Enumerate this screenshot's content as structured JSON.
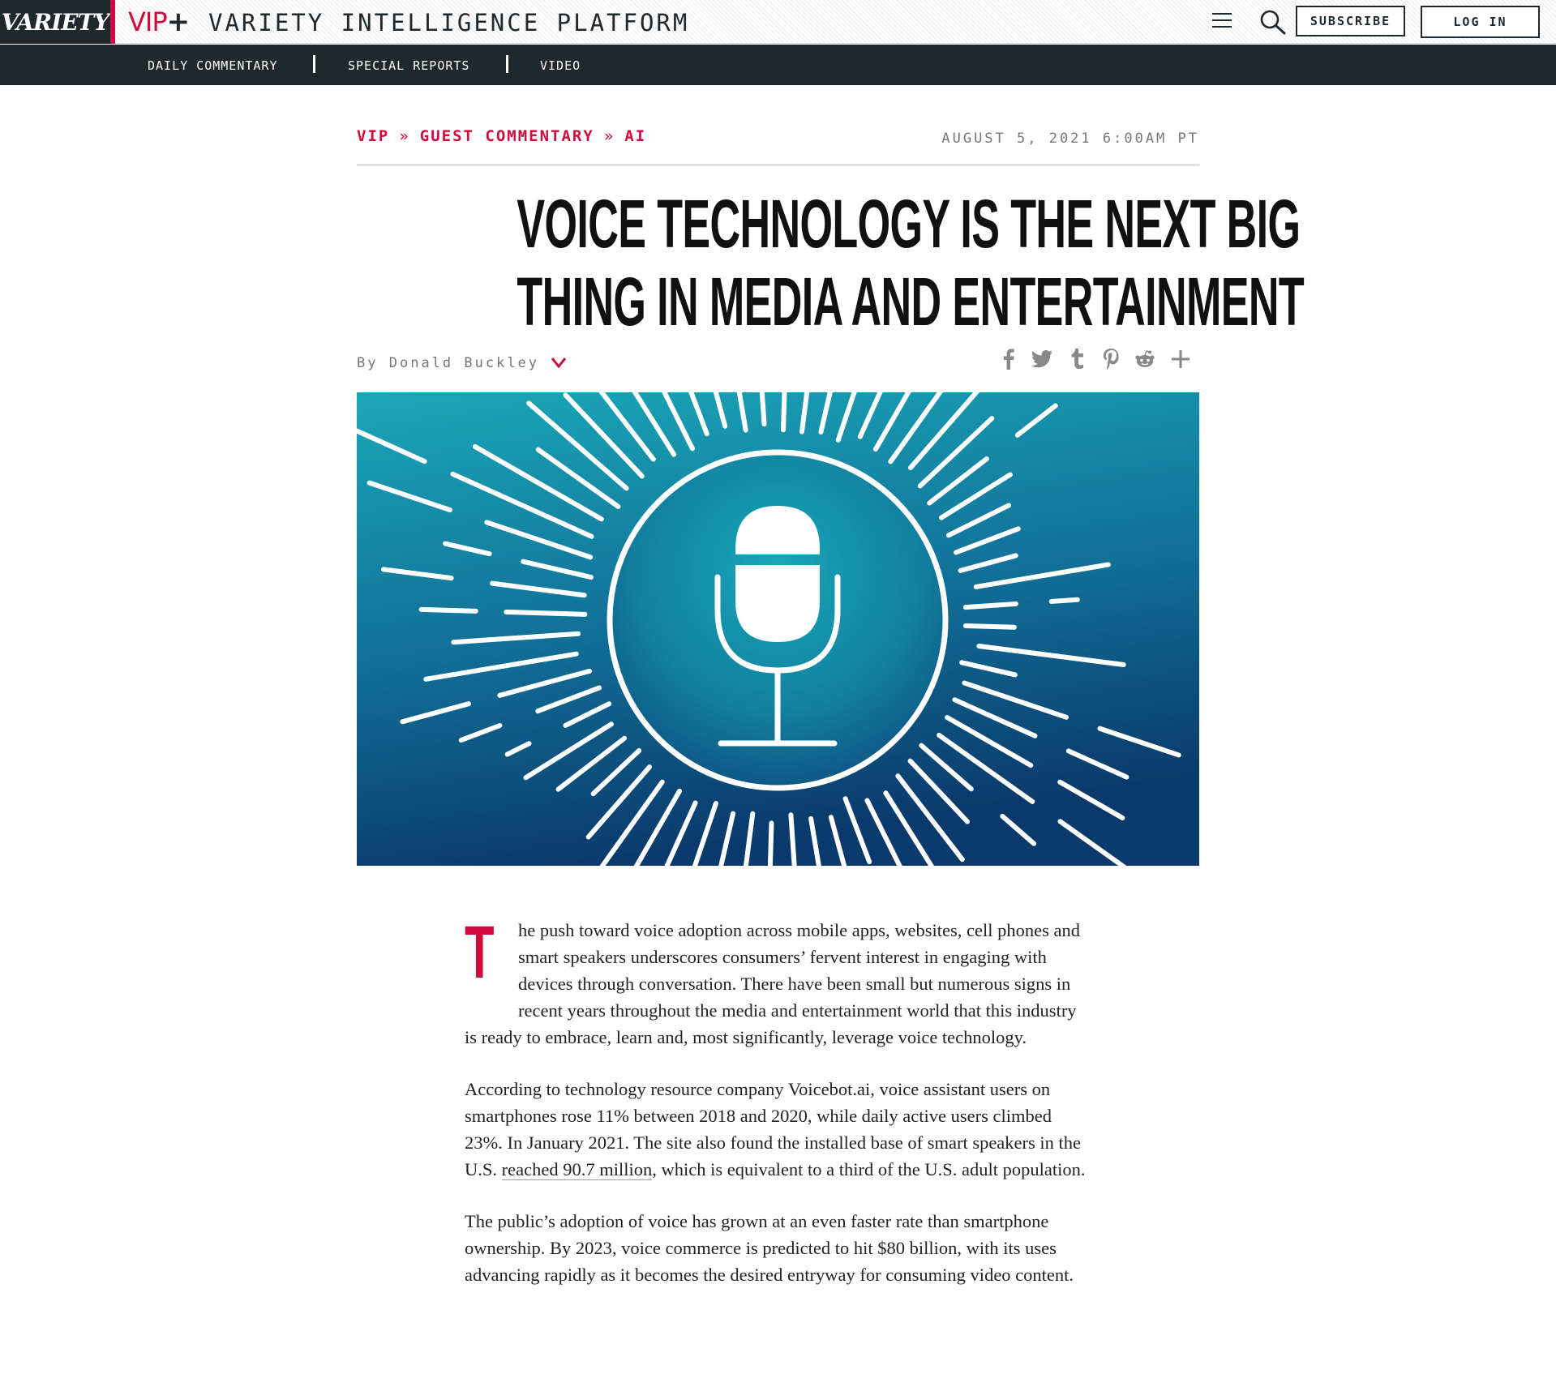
{
  "header": {
    "variety_logo": "VARIETY",
    "vip_logo": "VIP",
    "vip_plus": "+",
    "platform_title": "VARIETY INTELLIGENCE PLATFORM",
    "menu_icon": "hamburger-menu-icon",
    "search_icon": "search-icon",
    "subscribe_label": "SUBSCRIBE",
    "login_label": "LOG IN"
  },
  "subnav": {
    "items": [
      {
        "label": "DAILY COMMENTARY"
      },
      {
        "label": "SPECIAL REPORTS"
      },
      {
        "label": "VIDEO"
      }
    ]
  },
  "article": {
    "breadcrumb": [
      "VIP",
      "GUEST COMMENTARY",
      "AI"
    ],
    "breadcrumb_separator": "»",
    "date": "AUGUST 5, 2021 6:00AM PT",
    "headline_line1": "VOICE TECHNOLOGY IS THE NEXT BIG",
    "headline_line2": "THING IN MEDIA AND ENTERTAINMENT",
    "byline_prefix": "By",
    "author": "Donald Buckley",
    "share_icons": [
      "facebook-icon",
      "twitter-icon",
      "tumblr-icon",
      "pinterest-icon",
      "reddit-icon",
      "plus-icon"
    ],
    "hero_image": "microphone-illustration",
    "dropcap": "T",
    "paragraph1": "he push toward voice adoption across mobile apps, websites, cell phones and smart speakers underscores consumers’ fervent interest in engaging with devices through conversation. There have been small but numerous signs in recent years throughout the media and entertainment world that this industry is ready to embrace, learn and, most significantly, leverage voice technology.",
    "paragraph2_before": "According to technology resource company Voicebot.ai, voice assistant users on smartphones rose 11% between 2018 and 2020, while daily active users climbed 23%. In January 2021. The site also found the installed base of smart speakers in the U.S. ",
    "paragraph2_link": "reached 90.7 million",
    "paragraph2_after": ", which is equivalent to a third of the U.S. adult population.",
    "paragraph3": "The public’s adoption of voice has grown at an even faster rate than smartphone ownership. By 2023, voice commerce is predicted to hit $80 billion, with its uses advancing rapidly as it becomes the desired entryway for consuming video content."
  },
  "colors": {
    "brand_red": "#d10a3d",
    "nav_dark": "#1f282d",
    "hero_teal": "#19a6b8",
    "hero_navy": "#0b3f70"
  }
}
